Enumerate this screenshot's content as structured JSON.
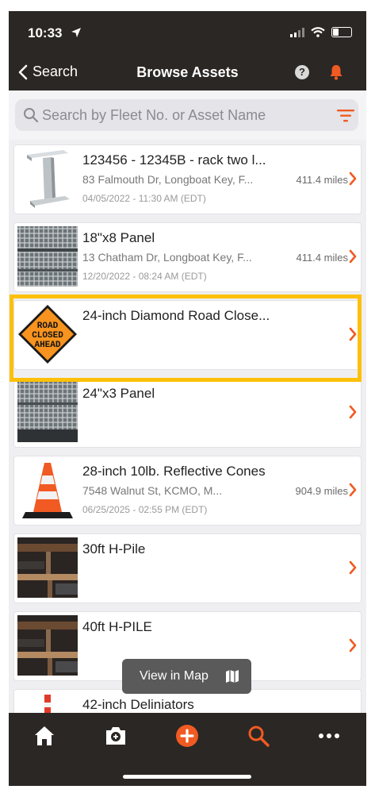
{
  "status_bar": {
    "time": "10:33"
  },
  "nav": {
    "back_label": "Search",
    "title": "Browse Assets",
    "help_label": "?"
  },
  "search": {
    "placeholder": "Search by Fleet No. or Asset Name"
  },
  "colors": {
    "accent": "#f15a22",
    "highlight": "#fcc009",
    "bar": "#2b2724"
  },
  "assets": [
    {
      "title": "123456 - 12345B - rack two l...",
      "address": "83 Falmouth Dr, Longboat Key, F...",
      "date": "04/05/2022 - 11:30 AM (EDT)",
      "distance": "411.4 miles",
      "icon": "steel-beam-image"
    },
    {
      "title": "18\"x8 Panel",
      "address": "13 Chatham Dr, Longboat Key, F...",
      "date": "12/20/2022 - 08:24 AM (EDT)",
      "distance": "411.4 miles",
      "icon": "panel-image"
    },
    {
      "title": "24-inch Diamond Road Close...",
      "address": "",
      "date": "",
      "distance": "",
      "icon": "road-closed-sign-image",
      "sign_text": [
        "ROAD",
        "CLOSED",
        "AHEAD"
      ]
    },
    {
      "title": "24\"x3 Panel",
      "address": "",
      "date": "",
      "distance": "",
      "icon": "panel-image"
    },
    {
      "title": "28-inch 10lb. Reflective Cones",
      "address": "7548 Walnut St, KCMO, M...",
      "date": "06/25/2025 - 02:55 PM (EDT)",
      "distance": "904.9 miles",
      "icon": "traffic-cone-image"
    },
    {
      "title": "30ft H-Pile",
      "address": "",
      "date": "",
      "distance": "",
      "icon": "h-pile-image"
    },
    {
      "title": "40ft H-PILE",
      "address": "",
      "date": "",
      "distance": "",
      "icon": "h-pile-image"
    },
    {
      "title": "42-inch Deliniators",
      "address": "",
      "date": "",
      "distance": "",
      "icon": "delineator-image"
    }
  ],
  "map_button": {
    "label": "View in Map"
  },
  "tab_bar": {
    "items": [
      "home-icon",
      "camera-icon",
      "add-icon",
      "search-icon",
      "more-icon"
    ]
  }
}
